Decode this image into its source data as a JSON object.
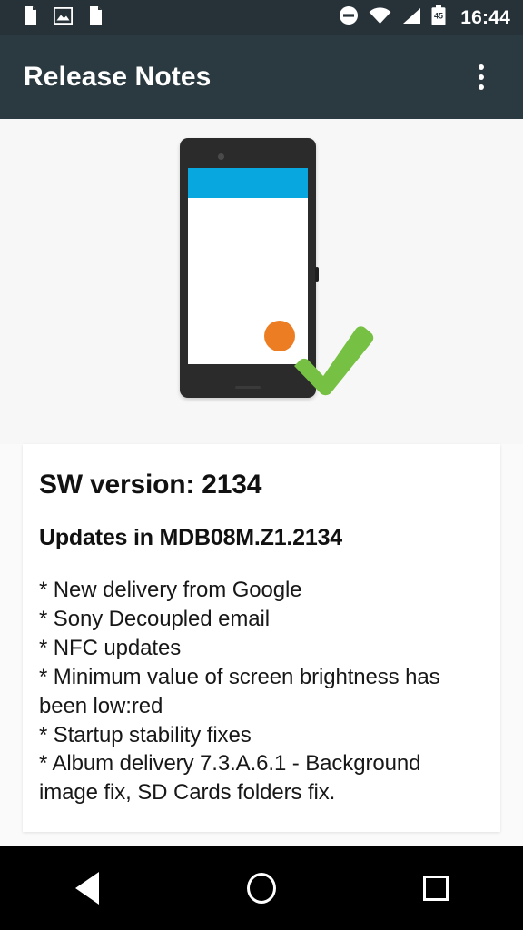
{
  "status_bar": {
    "icons_left": [
      "document-icon",
      "image-icon",
      "document-icon"
    ],
    "icons_right": [
      "do-not-disturb-icon",
      "wifi-icon",
      "cellular-signal-icon",
      "battery-icon"
    ],
    "battery_level": "45",
    "clock": "16:44"
  },
  "app_bar": {
    "title": "Release Notes",
    "overflow_icon": "more-vert-icon",
    "background_color": "#2b3a41"
  },
  "hero": {
    "illustration": "phone-with-checkmark-illustration",
    "phone_appbar_color": "#09a7e0",
    "fab_color": "#ed7d22",
    "check_color": "#76c043",
    "phone_body_color": "#2b2b2b"
  },
  "card": {
    "sw_version": "SW version: 2134",
    "updates_heading": "Updates in MDB08M.Z1.2134",
    "notes": [
      "* New delivery from Google",
      "* Sony Decoupled email",
      "* NFC updates",
      "* Minimum value of screen brightness has been low:red",
      "* Startup stability fixes",
      "* Album delivery 7.3.A.6.1 - Background image fix, SD Cards folders fix."
    ]
  },
  "nav_bar": {
    "back_icon": "back-triangle-icon",
    "home_icon": "home-circle-icon",
    "recents_icon": "recents-square-icon"
  }
}
